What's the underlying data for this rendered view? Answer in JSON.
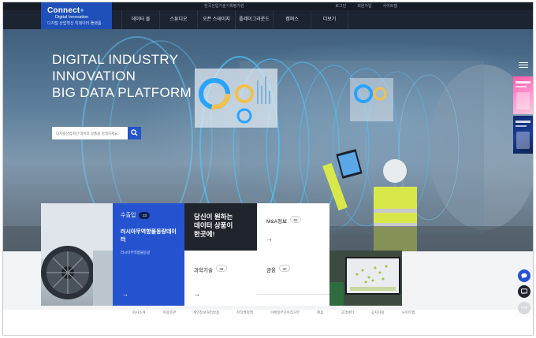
{
  "util": {
    "center_text": "한국산업기술기획평가원",
    "links": [
      "로그인",
      "회원가입",
      "사이트맵"
    ]
  },
  "logo": {
    "brand": "Connect",
    "line1": "Digital Innovation",
    "line2": "디지털 산업혁신 빅데이터 플랫폼"
  },
  "nav": {
    "items": [
      "데이터 몰",
      "스튜디오",
      "오픈 스테이지",
      "플레이그라운드",
      "캠퍼스",
      "더보기"
    ]
  },
  "hero": {
    "title_lines": [
      "DIGITAL INDUSTRY",
      "INNOVATION",
      "BIG DATA PLATFORM"
    ],
    "search_placeholder": "디지털산업혁신 데이터 상품을 검색하세요."
  },
  "cards": {
    "export": {
      "label": "수출입",
      "count": "13",
      "name": "러시아무역항물동량데이터",
      "sub": "러시아무역항물동량"
    },
    "promo": {
      "line1": "당신이 원하는",
      "line2": "데이터 상품이",
      "line3": "한곳에!"
    },
    "ma": {
      "label": "M&A정보",
      "count": "65"
    },
    "science": {
      "label": "과학기술",
      "count": "38"
    },
    "finance": {
      "label": "금융",
      "count": "30"
    },
    "arrow": "→"
  },
  "footer": {
    "links": [
      "회사소개",
      "이용약관",
      "개인정보처리방침",
      "저작권정책",
      "이메일무단수집거부",
      "제휴",
      "고객센터",
      "공지사항",
      "사이트맵"
    ]
  },
  "fab": {
    "top_label": "TOP"
  },
  "colors": {
    "accent": "#2553d0",
    "nav_bg": "#1c2331",
    "dark_card": "#1f242d"
  }
}
